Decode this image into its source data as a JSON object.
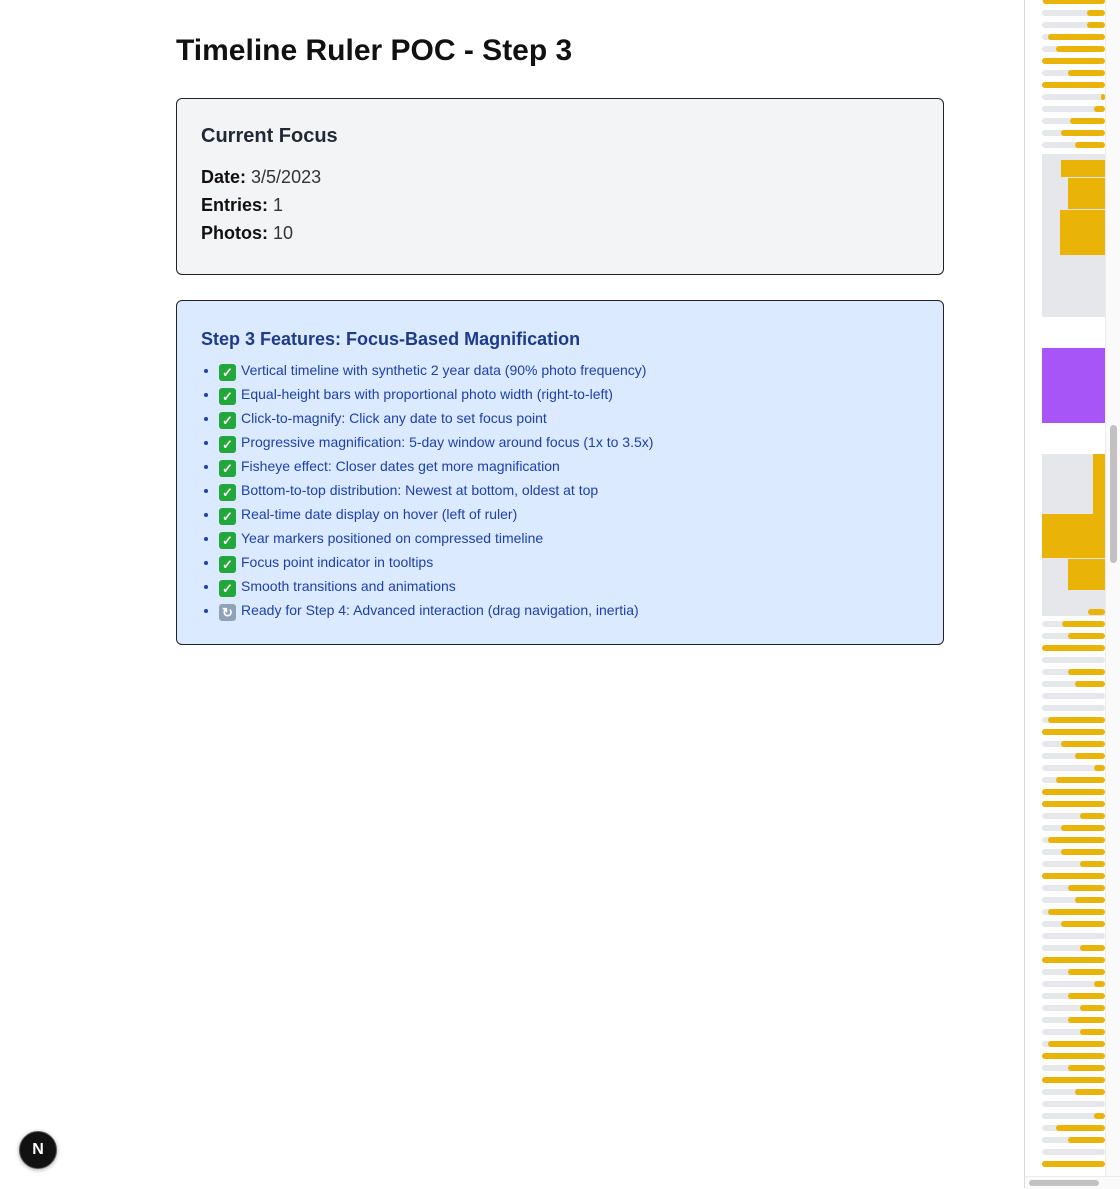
{
  "page": {
    "title": "Timeline Ruler POC - Step 3"
  },
  "current_focus": {
    "heading": "Current Focus",
    "date_label": "Date:",
    "date_value": "3/5/2023",
    "entries_label": "Entries:",
    "entries_value": "1",
    "photos_label": "Photos:",
    "photos_value": "10"
  },
  "features": {
    "heading": "Step 3 Features: Focus-Based Magnification",
    "items": [
      {
        "icon": "check-mark-icon",
        "text": "Vertical timeline with synthetic 2 year data (90% photo frequency)"
      },
      {
        "icon": "check-mark-icon",
        "text": "Equal-height bars with proportional photo width (right-to-left)"
      },
      {
        "icon": "check-mark-icon",
        "text": "Click-to-magnify: Click any date to set focus point"
      },
      {
        "icon": "check-mark-icon",
        "text": "Progressive magnification: 5-day window around focus (1x to 3.5x)"
      },
      {
        "icon": "check-mark-icon",
        "text": "Fisheye effect: Closer dates get more magnification"
      },
      {
        "icon": "check-mark-icon",
        "text": "Bottom-to-top distribution: Newest at bottom, oldest at top"
      },
      {
        "icon": "check-mark-icon",
        "text": "Real-time date display on hover (left of ruler)"
      },
      {
        "icon": "check-mark-icon",
        "text": "Year markers positioned on compressed timeline"
      },
      {
        "icon": "check-mark-icon",
        "text": "Focus point indicator in tooltips"
      },
      {
        "icon": "check-mark-icon",
        "text": "Smooth transitions and animations"
      },
      {
        "icon": "refresh-icon",
        "text": "Ready for Step 4: Advanced interaction (drag navigation, inertia)"
      }
    ]
  },
  "timeline_ruler": {
    "photo_bar_color": "#eab308",
    "empty_bar_color": "#e5e7eb",
    "focus_color": "#a855f7"
  },
  "dev_badge": {
    "label": "N"
  }
}
